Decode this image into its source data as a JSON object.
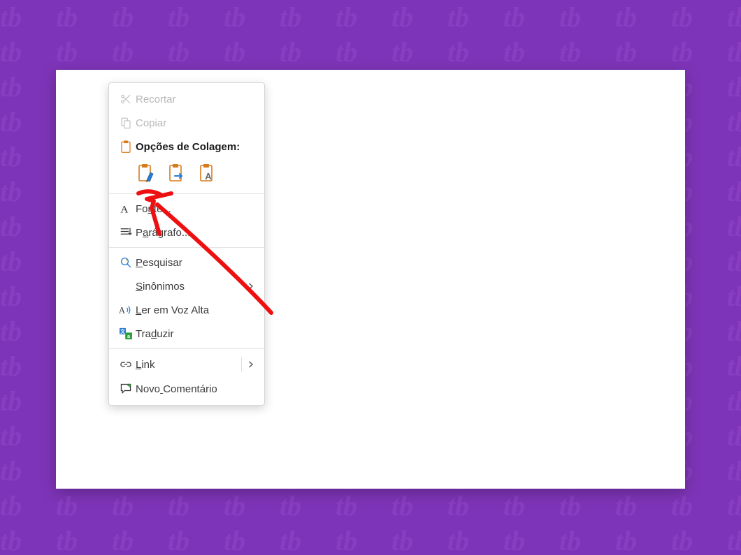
{
  "menu": {
    "recortar": "Recortar",
    "copiar": "Copiar",
    "opcoes_colagem": "Opções de Colagem:",
    "fonte": "Fonte...",
    "paragrafo": "Parágrafo...",
    "pesquisar": "Pesquisar",
    "sinonimos": "Sinônimos",
    "ler_em_voz_alta": "Ler em Voz Alta",
    "traduzir": "Traduzir",
    "link": "Link",
    "novo_comentario": "Novo Comentário"
  },
  "underline_index": {
    "recortar": -1,
    "copiar": -1,
    "fonte": 2,
    "paragrafo": 1,
    "pesquisar": 0,
    "sinonimos": 0,
    "ler_em_voz_alta": 0,
    "traduzir": 3,
    "link": 0,
    "novo_comentario": 4
  }
}
